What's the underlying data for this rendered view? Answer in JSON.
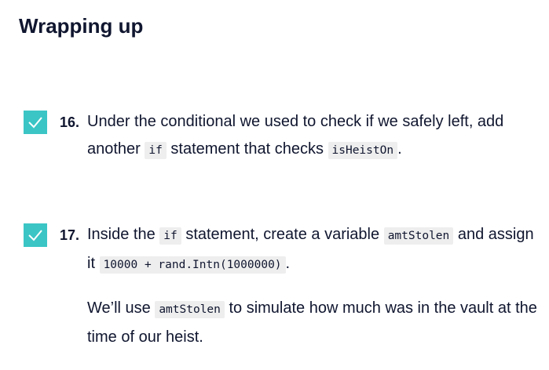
{
  "title": "Wrapping up",
  "tasks": [
    {
      "checked": true,
      "number": "16.",
      "p1": {
        "t1": "Under the conditional we used to check if we safely left, add another ",
        "c1": "if",
        "t2": " statement that checks ",
        "c2": "isHeistOn",
        "t3": "."
      }
    },
    {
      "checked": true,
      "number": "17.",
      "p1": {
        "t1": "Inside the ",
        "c1": "if",
        "t2": " statement, create a variable ",
        "c2": "amtStolen",
        "t3": " and assign it ",
        "c3": "10000 + rand.Intn(1000000)",
        "t4": "."
      },
      "p2": {
        "t1": "We’ll use ",
        "c1": "amtStolen",
        "t2": " to simulate how much was in the vault at the time of our heist."
      }
    }
  ],
  "colors": {
    "checkbox": "#3bc5c5",
    "text": "#10162f",
    "code_bg": "#eeeeee"
  },
  "icons": {
    "checkbox": "checkmark-icon"
  }
}
